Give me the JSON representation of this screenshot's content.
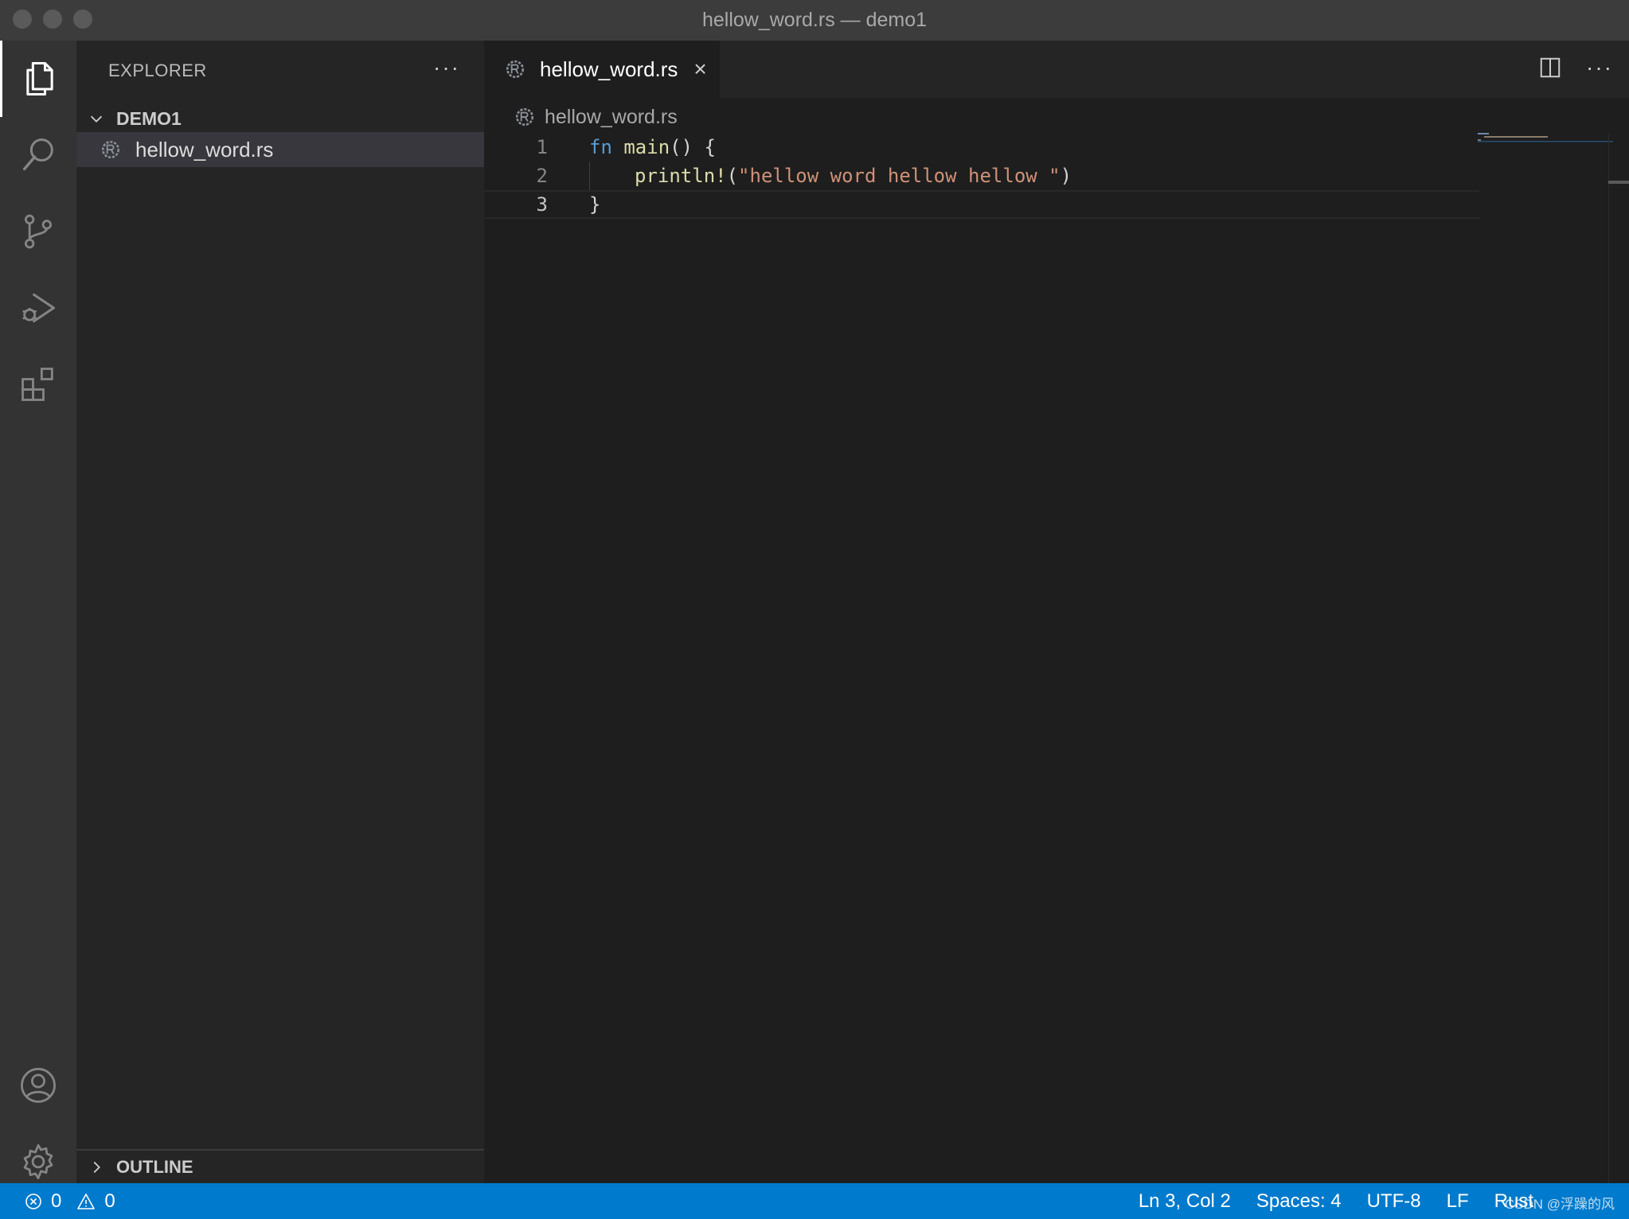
{
  "window": {
    "title": "hellow_word.rs — demo1"
  },
  "activity_bar": {
    "items": [
      "files-icon",
      "search-icon",
      "source-control-icon",
      "run-debug-icon",
      "extensions-icon"
    ],
    "bottom": [
      "account-icon",
      "gear-icon"
    ]
  },
  "sidebar": {
    "header": "EXPLORER",
    "more": "···",
    "folder": "DEMO1",
    "files": [
      {
        "name": "hellow_word.rs",
        "icon": "rust-file-icon"
      }
    ],
    "outline": "OUTLINE"
  },
  "editor": {
    "tab": {
      "label": "hellow_word.rs",
      "close": "×"
    },
    "breadcrumb": "hellow_word.rs",
    "lines": [
      {
        "num": "1",
        "kw": "fn",
        "fn": "main",
        "rest": "() {"
      },
      {
        "num": "2",
        "macro": "println!",
        "open": "(",
        "str": "\"hellow word hellow hellow \"",
        "close": ")"
      },
      {
        "num": "3",
        "text": "}"
      }
    ],
    "more": "···"
  },
  "status_bar": {
    "errors": "0",
    "warnings": "0",
    "position": "Ln 3, Col 2",
    "spaces": "Spaces: 4",
    "encoding": "UTF-8",
    "eol": "LF",
    "language": "Rust",
    "watermark": "CSDN @浮躁的风"
  },
  "colors": {
    "accent": "#007acc",
    "keyword": "#569cd6",
    "function": "#dcdcaa",
    "string": "#ce9178"
  }
}
